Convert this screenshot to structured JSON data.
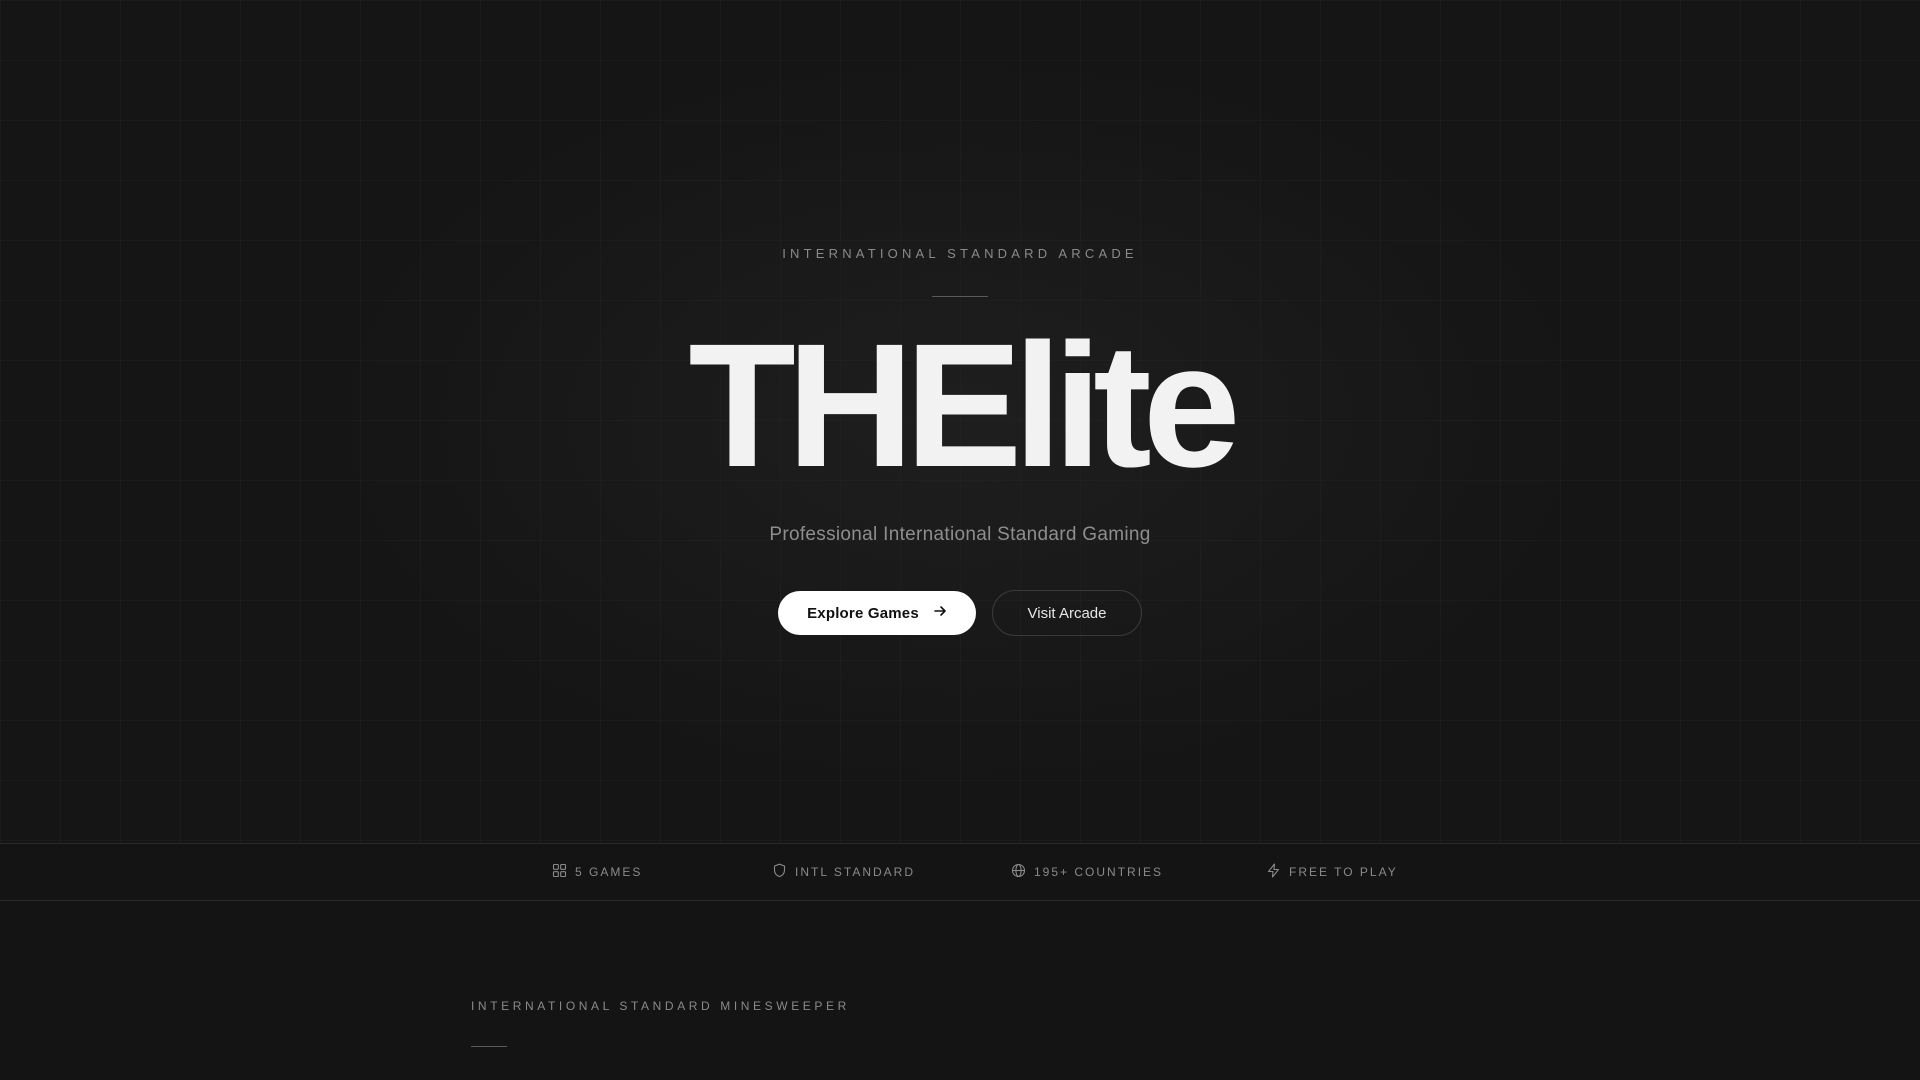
{
  "hero": {
    "eyebrow": "INTERNATIONAL STANDARD ARCADE",
    "title": "THElite",
    "subtitle": "Professional International Standard Gaming",
    "primary_button": {
      "label": "Explore Games",
      "icon": "arrow-right-icon"
    },
    "secondary_button": {
      "label": "Visit Arcade"
    }
  },
  "stats": [
    {
      "label": "5 GAMES",
      "icon": "grid-icon"
    },
    {
      "label": "INTL STANDARD",
      "icon": "shield-icon"
    },
    {
      "label": "195+ COUNTRIES",
      "icon": "globe-icon"
    },
    {
      "label": "FREE TO PLAY",
      "icon": "lightning-icon"
    }
  ],
  "section": {
    "eyebrow": "INTERNATIONAL STANDARD MINESWEEPER"
  },
  "colors": {
    "background": "#141414",
    "title": "#f2f2f2",
    "muted": "#8a8a8a",
    "primary_button_bg": "#ffffff"
  }
}
